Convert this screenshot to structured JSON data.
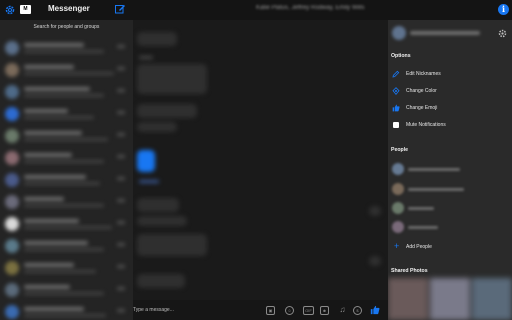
{
  "app": {
    "title": "Messenger"
  },
  "conversation": {
    "title": "Katie Platus, Jeffrey Rodway, Emily Wills"
  },
  "sidebar": {
    "search_placeholder": "Search for people and groups"
  },
  "composer": {
    "placeholder": "Type a message...",
    "icons": [
      "image-icon",
      "sticker-icon",
      "gif-icon",
      "emoji-icon",
      "camera-icon",
      "microphone-icon",
      "payment-icon",
      "like-icon"
    ]
  },
  "panel": {
    "options_header": "Options",
    "options": [
      {
        "label": "Edit Nicknames",
        "icon": "pencil-icon"
      },
      {
        "label": "Change Color",
        "icon": "color-icon"
      },
      {
        "label": "Change Emoji",
        "icon": "thumbs-up-icon"
      },
      {
        "label": "Mute Notifications",
        "icon": "checkbox"
      }
    ],
    "people_header": "People",
    "add_people": "Add People",
    "shared_photos_header": "Shared Photos"
  },
  "colors": {
    "accent": "#1877f2",
    "background": "#1d1d1d",
    "panel": "#2a2a2a"
  }
}
